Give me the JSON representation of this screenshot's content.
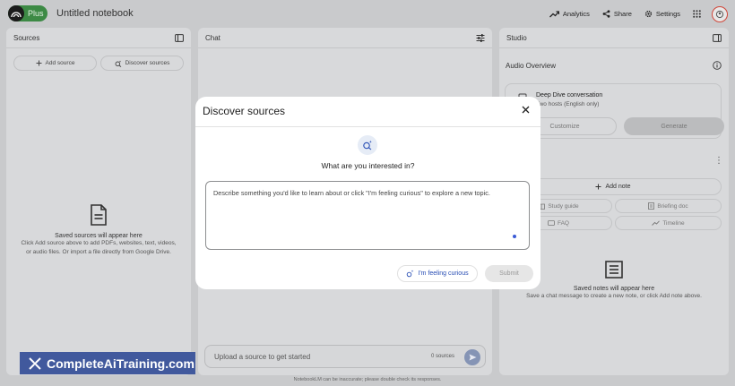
{
  "header": {
    "brand_badge": "Plus",
    "notebook_title": "Untitled notebook",
    "actions": {
      "analytics": "Analytics",
      "share": "Share",
      "settings": "Settings"
    }
  },
  "sources": {
    "title": "Sources",
    "add_source": "Add source",
    "discover_sources": "Discover sources",
    "empty_title": "Saved sources will appear here",
    "empty_desc_1": "Click Add source above to add PDFs, websites, text, videos,",
    "empty_desc_2": "or audio files. Or import a file directly from Google Drive."
  },
  "chat": {
    "title": "Chat",
    "input_placeholder": "Upload a source to get started",
    "sources_count": "0 sources"
  },
  "studio": {
    "title": "Studio",
    "audio_overview": "Audio Overview",
    "deep_dive_title": "Deep Dive conversation",
    "deep_dive_sub": "Two hosts (English only)",
    "customize": "Customize",
    "generate": "Generate",
    "add_note": "Add note",
    "study_guide": "Study guide",
    "briefing_doc": "Briefing doc",
    "faq": "FAQ",
    "timeline": "Timeline",
    "notes_empty_title": "Saved notes will appear here",
    "notes_empty_desc": "Save a chat message to create a new note, or click Add note above."
  },
  "modal": {
    "title": "Discover sources",
    "question": "What are you interested in?",
    "textarea_placeholder": "Describe something you'd like to learn about or click \"I'm feeling curious\" to explore a new topic.",
    "curious_button": "I'm feeling curious",
    "submit_button": "Submit"
  },
  "footer": {
    "disclaimer": "NotebookLM can be inaccurate; please double check its responses."
  },
  "watermark": {
    "text": "CompleteAiTraining.com"
  },
  "colors": {
    "background": "#c9cacc",
    "panel": "#d8d9db",
    "brand_green": "#3d8a45",
    "accent_blue": "#2a4fb5",
    "watermark_bg": "#41599d"
  }
}
